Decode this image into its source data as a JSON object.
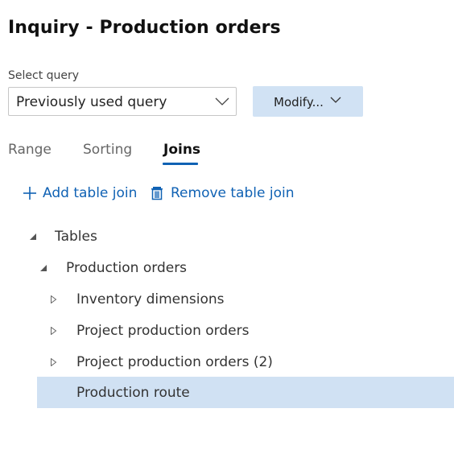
{
  "header": {
    "title": "Inquiry - Production orders"
  },
  "query": {
    "label": "Select query",
    "selected_value": "Previously used query",
    "modify_label": "Modify..."
  },
  "tabs": [
    {
      "label": "Range",
      "active": false
    },
    {
      "label": "Sorting",
      "active": false
    },
    {
      "label": "Joins",
      "active": true
    }
  ],
  "actions": {
    "add_label": "Add table join",
    "add_icon": "plus-icon",
    "remove_label": "Remove table join",
    "remove_icon": "trash-icon"
  },
  "tree": {
    "items": [
      {
        "label": "Tables",
        "level": 0,
        "state": "expanded"
      },
      {
        "label": "Production orders",
        "level": 1,
        "state": "expanded"
      },
      {
        "label": "Inventory dimensions",
        "level": 2,
        "state": "collapsed"
      },
      {
        "label": "Project production orders",
        "level": 2,
        "state": "collapsed"
      },
      {
        "label": "Project production orders (2)",
        "level": 2,
        "state": "collapsed"
      },
      {
        "label": "Production route",
        "level": 2,
        "state": "leaf",
        "selected": true
      }
    ]
  },
  "colors": {
    "accent": "#1062b4",
    "selection": "#d0e1f3",
    "button_bg": "#d1e2f4"
  }
}
